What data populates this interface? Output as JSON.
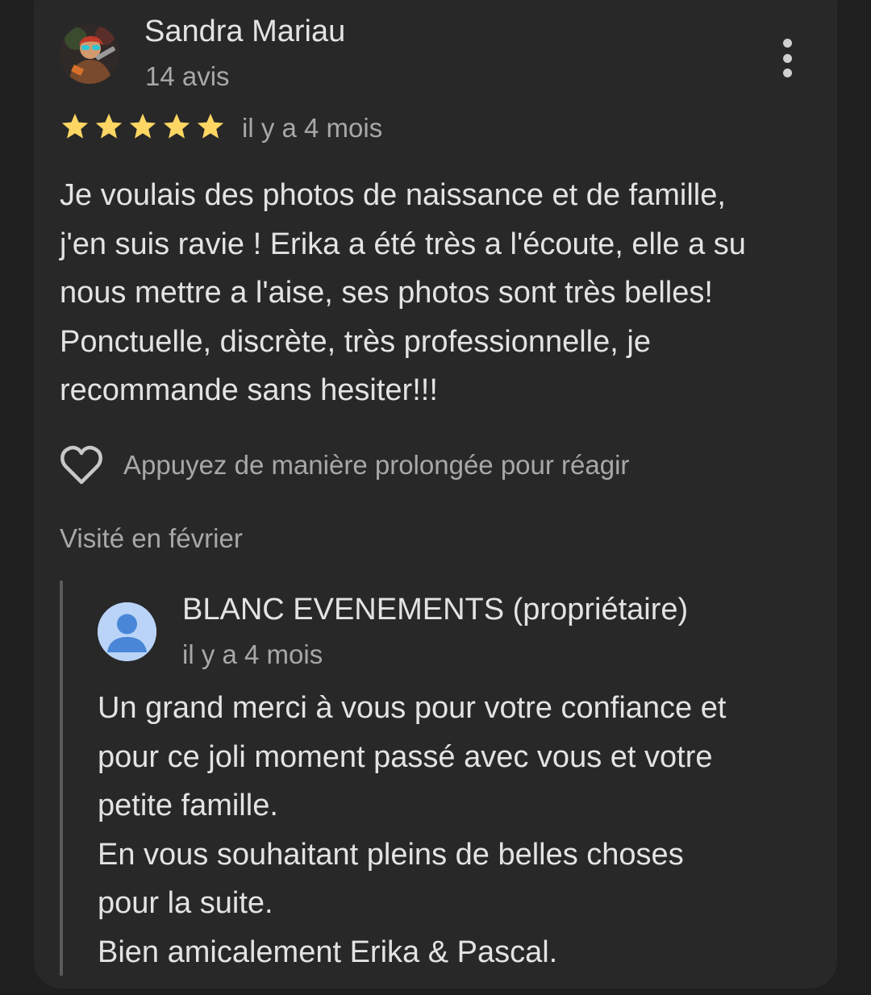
{
  "review": {
    "author_name": "Sandra Mariau",
    "author_reviews": "14 avis",
    "rating": 5,
    "rating_max": 5,
    "star_color": "#fdd663",
    "date": "il y a 4 mois",
    "text_lines": [
      "Je voulais des photos de naissance et de famille,",
      "j'en suis ravie ! Erika a été très a l'écoute, elle a su",
      "nous mettre a l'aise, ses photos sont très belles!",
      "Ponctuelle, discrète, très professionnelle, je",
      "recommande sans hesiter!!!"
    ],
    "react_hint": "Appuyez de manière prolongée pour réagir",
    "visited": "Visité en février"
  },
  "owner_reply": {
    "name": "BLANC EVENEMENTS (propriétaire)",
    "date": "il y a 4 mois",
    "text_lines": [
      "Un grand merci à vous pour votre confiance et",
      "pour ce joli moment passé avec vous et votre",
      "petite famille.",
      "En vous souhaitant pleins de belles choses",
      "pour la suite.",
      "Bien amicalement Erika & Pascal."
    ]
  },
  "icons": {
    "more": "more-vert-icon",
    "heart": "heart-outline-icon",
    "owner_avatar": "person-icon"
  }
}
